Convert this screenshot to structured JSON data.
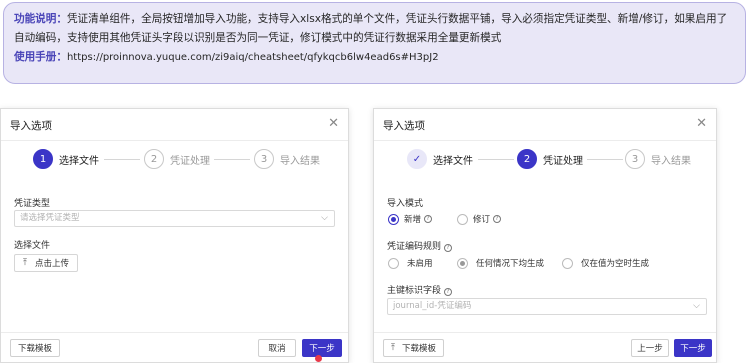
{
  "info": {
    "feature_label": "功能说明：",
    "feature_text": "凭证清单组件，全局按钮增加导入功能，支持导入xlsx格式的单个文件，凭证头行数据平铺，导入必须指定凭证类型、新增/修订，如果启用了自动编码，支持使用其他凭证头字段以识别是否为同一凭证，修订模式中的凭证行数据采用全量更新模式",
    "manual_label": "使用手册：",
    "manual_url": "https://proinnova.yuque.com/zi9aiq/cheatsheet/qfykqcb6lw4ead6s#H3pJ2"
  },
  "dialog_left": {
    "title": "导入选项",
    "steps": [
      {
        "num": "1",
        "label": "选择文件",
        "state": "active"
      },
      {
        "num": "2",
        "label": "凭证处理",
        "state": "pending"
      },
      {
        "num": "3",
        "label": "导入结果",
        "state": "pending"
      }
    ],
    "voucher_type_label": "凭证类型",
    "voucher_type_placeholder": "请选择凭证类型",
    "choose_file_label": "选择文件",
    "upload_label": "点击上传",
    "download_template": "下载模板",
    "cancel": "取消",
    "next": "下一步"
  },
  "dialog_right": {
    "title": "导入选项",
    "steps": [
      {
        "num": "✓",
        "label": "选择文件",
        "state": "done"
      },
      {
        "num": "2",
        "label": "凭证处理",
        "state": "active"
      },
      {
        "num": "3",
        "label": "导入结果",
        "state": "pending"
      }
    ],
    "import_mode_label": "导入模式",
    "mode_options": [
      {
        "label": "新增",
        "checked": true
      },
      {
        "label": "修订",
        "checked": false
      }
    ],
    "encoding_rule_label": "凭证编码规则",
    "encoding_options": [
      {
        "label": "未启用",
        "checked": false
      },
      {
        "label": "任何情况下均生成",
        "checked": true
      },
      {
        "label": "仅在值为空时生成",
        "checked": false
      }
    ],
    "key_field_label": "主键标识字段",
    "key_field_value": "journal_id-凭证编码",
    "download_template": "下载模板",
    "prev": "上一步",
    "next": "下一步"
  },
  "colors": {
    "accent": "#3b35c7",
    "info_bg": "#e9e7f7",
    "notify_dot": "#e8394a"
  },
  "icons": {
    "close": "close-icon",
    "upload": "upload-icon",
    "chevron": "chevron-down-icon",
    "help": "question-circle-icon",
    "check": "check-icon"
  }
}
